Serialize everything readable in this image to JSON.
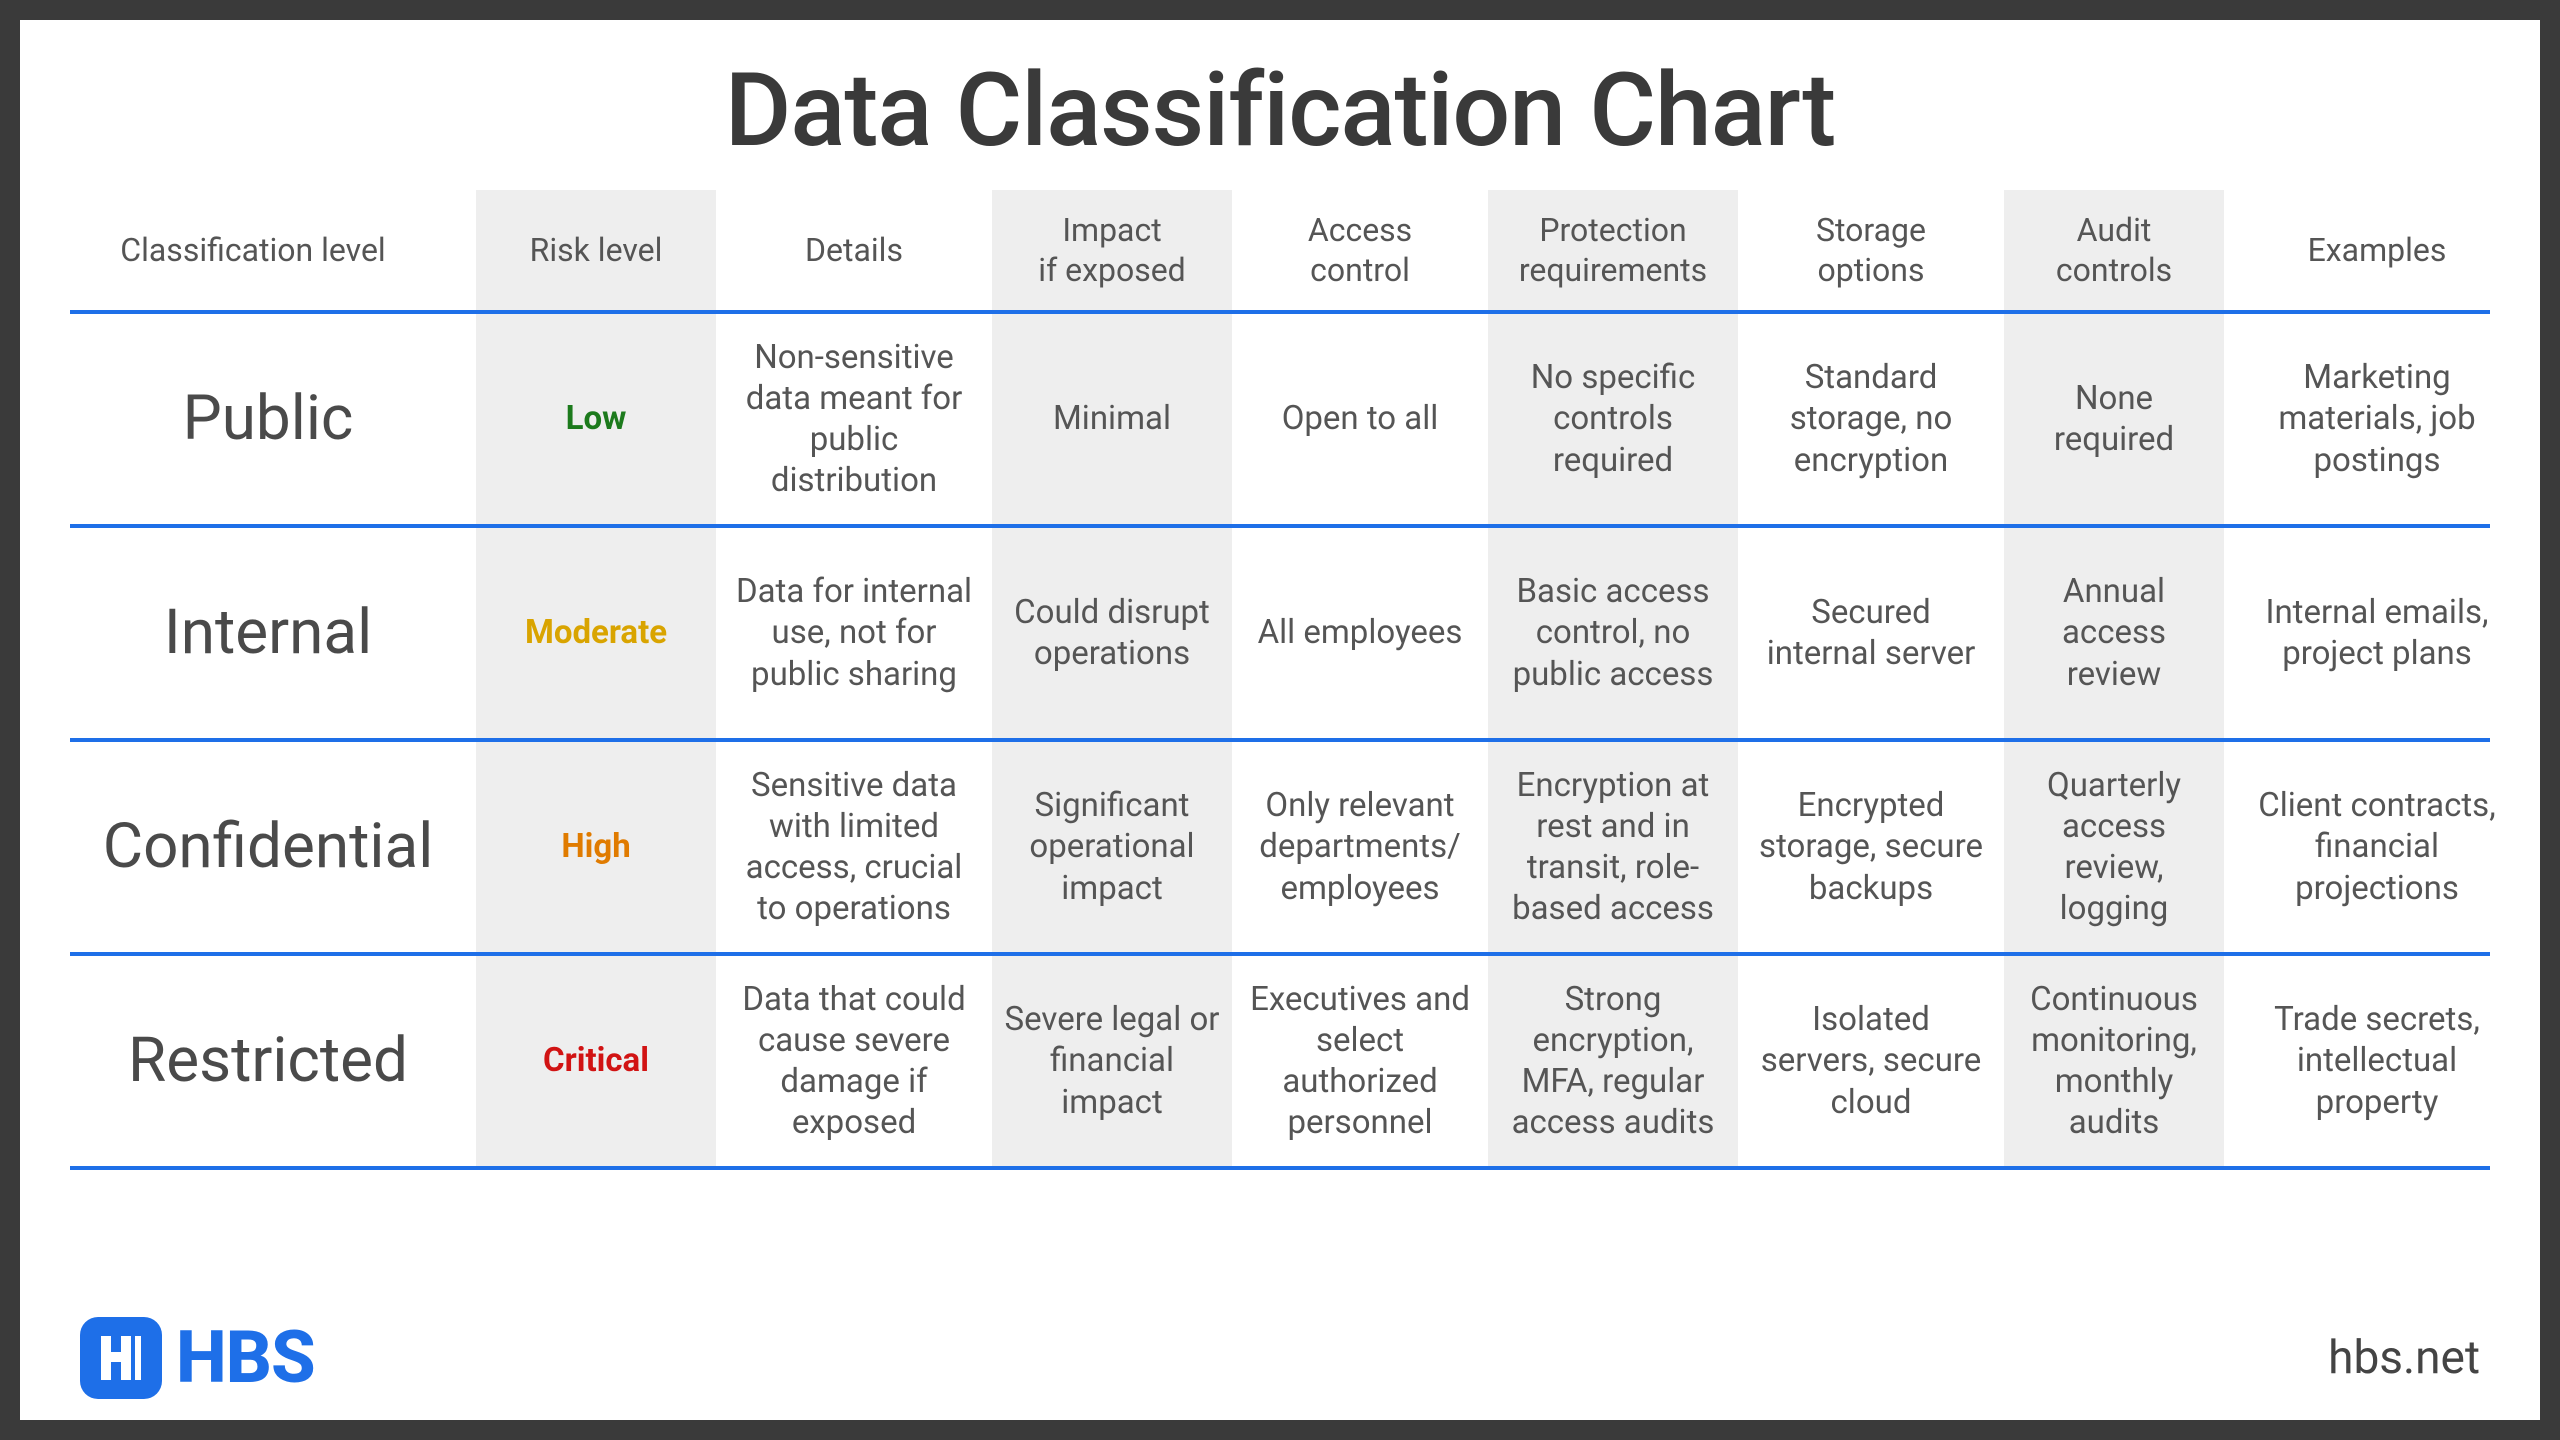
{
  "title": "Data Classification Chart",
  "columns": [
    "Classification level",
    "Risk level",
    "Details",
    "Impact\nif exposed",
    "Access\ncontrol",
    "Protection\nrequirements",
    "Storage\noptions",
    "Audit\ncontrols",
    "Examples"
  ],
  "shaded_columns": [
    1,
    3,
    5,
    7
  ],
  "risk_colors": {
    "Low": "#1c7a1c",
    "Moderate": "#d9a400",
    "High": "#e07b00",
    "Critical": "#d11313"
  },
  "rows": [
    {
      "level": "Public",
      "risk": "Low",
      "details": "Non-sensitive data meant for public distribution",
      "impact": "Minimal",
      "access": "Open to all",
      "protection": "No specific controls required",
      "storage": "Standard storage, no encryption",
      "audit": "None required",
      "examples": "Marketing materials, job postings"
    },
    {
      "level": "Internal",
      "risk": "Moderate",
      "details": "Data for internal use, not for public sharing",
      "impact": "Could disrupt operations",
      "access": "All employees",
      "protection": "Basic access control, no public access",
      "storage": "Secured internal server",
      "audit": "Annual access review",
      "examples": "Internal emails, project plans"
    },
    {
      "level": "Confidential",
      "risk": "High",
      "details": "Sensitive data with limited access, crucial to operations",
      "impact": "Significant operational impact",
      "access": "Only relevant departments/ employees",
      "protection": "Encryption at rest and in transit, role-based access",
      "storage": "Encrypted storage, secure backups",
      "audit": "Quarterly access review, logging",
      "examples": "Client contracts, financial projections"
    },
    {
      "level": "Restricted",
      "risk": "Critical",
      "details": "Data that could cause severe damage if exposed",
      "impact": "Severe legal or financial impact",
      "access": "Executives and select authorized personnel",
      "protection": "Strong encryption, MFA, regular access audits",
      "storage": "Isolated servers, secure cloud",
      "audit": "Continuous monitoring, monthly audits",
      "examples": "Trade secrets, intellectual property"
    }
  ],
  "footer": {
    "brand": "HBS",
    "site": "hbs.net"
  },
  "chart_data": {
    "type": "table",
    "title": "Data Classification Chart",
    "columns": [
      "Classification level",
      "Risk level",
      "Details",
      "Impact if exposed",
      "Access control",
      "Protection requirements",
      "Storage options",
      "Audit controls",
      "Examples"
    ],
    "rows": [
      [
        "Public",
        "Low",
        "Non-sensitive data meant for public distribution",
        "Minimal",
        "Open to all",
        "No specific controls required",
        "Standard storage, no encryption",
        "None required",
        "Marketing materials, job postings"
      ],
      [
        "Internal",
        "Moderate",
        "Data for internal use, not for public sharing",
        "Could disrupt operations",
        "All employees",
        "Basic access control, no public access",
        "Secured internal server",
        "Annual access review",
        "Internal emails, project plans"
      ],
      [
        "Confidential",
        "High",
        "Sensitive data with limited access, crucial to operations",
        "Significant operational impact",
        "Only relevant departments/employees",
        "Encryption at rest and in transit, role-based access",
        "Encrypted storage, secure backups",
        "Quarterly access review, logging",
        "Client contracts, financial projections"
      ],
      [
        "Restricted",
        "Critical",
        "Data that could cause severe damage if exposed",
        "Severe legal or financial impact",
        "Executives and select authorized personnel",
        "Strong encryption, MFA, regular access audits",
        "Isolated servers, secure cloud",
        "Continuous monitoring, monthly audits",
        "Trade secrets, intellectual property"
      ]
    ]
  }
}
